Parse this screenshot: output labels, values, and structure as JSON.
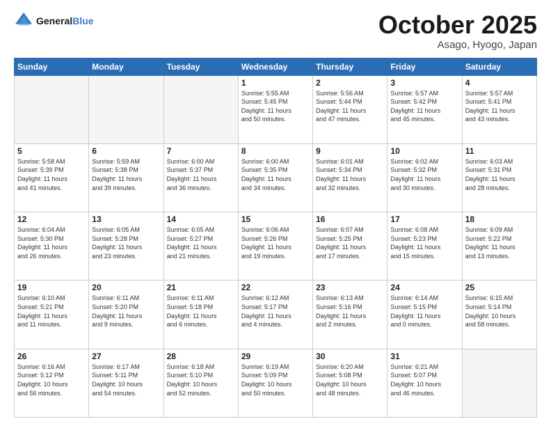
{
  "header": {
    "logo_line1": "General",
    "logo_line2": "Blue",
    "month": "October 2025",
    "location": "Asago, Hyogo, Japan"
  },
  "weekdays": [
    "Sunday",
    "Monday",
    "Tuesday",
    "Wednesday",
    "Thursday",
    "Friday",
    "Saturday"
  ],
  "weeks": [
    [
      {
        "day": "",
        "info": ""
      },
      {
        "day": "",
        "info": ""
      },
      {
        "day": "",
        "info": ""
      },
      {
        "day": "1",
        "info": "Sunrise: 5:55 AM\nSunset: 5:45 PM\nDaylight: 11 hours\nand 50 minutes."
      },
      {
        "day": "2",
        "info": "Sunrise: 5:56 AM\nSunset: 5:44 PM\nDaylight: 11 hours\nand 47 minutes."
      },
      {
        "day": "3",
        "info": "Sunrise: 5:57 AM\nSunset: 5:42 PM\nDaylight: 11 hours\nand 45 minutes."
      },
      {
        "day": "4",
        "info": "Sunrise: 5:57 AM\nSunset: 5:41 PM\nDaylight: 11 hours\nand 43 minutes."
      }
    ],
    [
      {
        "day": "5",
        "info": "Sunrise: 5:58 AM\nSunset: 5:39 PM\nDaylight: 11 hours\nand 41 minutes."
      },
      {
        "day": "6",
        "info": "Sunrise: 5:59 AM\nSunset: 5:38 PM\nDaylight: 11 hours\nand 39 minutes."
      },
      {
        "day": "7",
        "info": "Sunrise: 6:00 AM\nSunset: 5:37 PM\nDaylight: 11 hours\nand 36 minutes."
      },
      {
        "day": "8",
        "info": "Sunrise: 6:00 AM\nSunset: 5:35 PM\nDaylight: 11 hours\nand 34 minutes."
      },
      {
        "day": "9",
        "info": "Sunrise: 6:01 AM\nSunset: 5:34 PM\nDaylight: 11 hours\nand 32 minutes."
      },
      {
        "day": "10",
        "info": "Sunrise: 6:02 AM\nSunset: 5:32 PM\nDaylight: 11 hours\nand 30 minutes."
      },
      {
        "day": "11",
        "info": "Sunrise: 6:03 AM\nSunset: 5:31 PM\nDaylight: 11 hours\nand 28 minutes."
      }
    ],
    [
      {
        "day": "12",
        "info": "Sunrise: 6:04 AM\nSunset: 5:30 PM\nDaylight: 11 hours\nand 26 minutes."
      },
      {
        "day": "13",
        "info": "Sunrise: 6:05 AM\nSunset: 5:28 PM\nDaylight: 11 hours\nand 23 minutes."
      },
      {
        "day": "14",
        "info": "Sunrise: 6:05 AM\nSunset: 5:27 PM\nDaylight: 11 hours\nand 21 minutes."
      },
      {
        "day": "15",
        "info": "Sunrise: 6:06 AM\nSunset: 5:26 PM\nDaylight: 11 hours\nand 19 minutes."
      },
      {
        "day": "16",
        "info": "Sunrise: 6:07 AM\nSunset: 5:25 PM\nDaylight: 11 hours\nand 17 minutes."
      },
      {
        "day": "17",
        "info": "Sunrise: 6:08 AM\nSunset: 5:23 PM\nDaylight: 11 hours\nand 15 minutes."
      },
      {
        "day": "18",
        "info": "Sunrise: 6:09 AM\nSunset: 5:22 PM\nDaylight: 11 hours\nand 13 minutes."
      }
    ],
    [
      {
        "day": "19",
        "info": "Sunrise: 6:10 AM\nSunset: 5:21 PM\nDaylight: 11 hours\nand 11 minutes."
      },
      {
        "day": "20",
        "info": "Sunrise: 6:11 AM\nSunset: 5:20 PM\nDaylight: 11 hours\nand 9 minutes."
      },
      {
        "day": "21",
        "info": "Sunrise: 6:11 AM\nSunset: 5:18 PM\nDaylight: 11 hours\nand 6 minutes."
      },
      {
        "day": "22",
        "info": "Sunrise: 6:12 AM\nSunset: 5:17 PM\nDaylight: 11 hours\nand 4 minutes."
      },
      {
        "day": "23",
        "info": "Sunrise: 6:13 AM\nSunset: 5:16 PM\nDaylight: 11 hours\nand 2 minutes."
      },
      {
        "day": "24",
        "info": "Sunrise: 6:14 AM\nSunset: 5:15 PM\nDaylight: 11 hours\nand 0 minutes."
      },
      {
        "day": "25",
        "info": "Sunrise: 6:15 AM\nSunset: 5:14 PM\nDaylight: 10 hours\nand 58 minutes."
      }
    ],
    [
      {
        "day": "26",
        "info": "Sunrise: 6:16 AM\nSunset: 5:12 PM\nDaylight: 10 hours\nand 56 minutes."
      },
      {
        "day": "27",
        "info": "Sunrise: 6:17 AM\nSunset: 5:11 PM\nDaylight: 10 hours\nand 54 minutes."
      },
      {
        "day": "28",
        "info": "Sunrise: 6:18 AM\nSunset: 5:10 PM\nDaylight: 10 hours\nand 52 minutes."
      },
      {
        "day": "29",
        "info": "Sunrise: 6:19 AM\nSunset: 5:09 PM\nDaylight: 10 hours\nand 50 minutes."
      },
      {
        "day": "30",
        "info": "Sunrise: 6:20 AM\nSunset: 5:08 PM\nDaylight: 10 hours\nand 48 minutes."
      },
      {
        "day": "31",
        "info": "Sunrise: 6:21 AM\nSunset: 5:07 PM\nDaylight: 10 hours\nand 46 minutes."
      },
      {
        "day": "",
        "info": ""
      }
    ]
  ]
}
